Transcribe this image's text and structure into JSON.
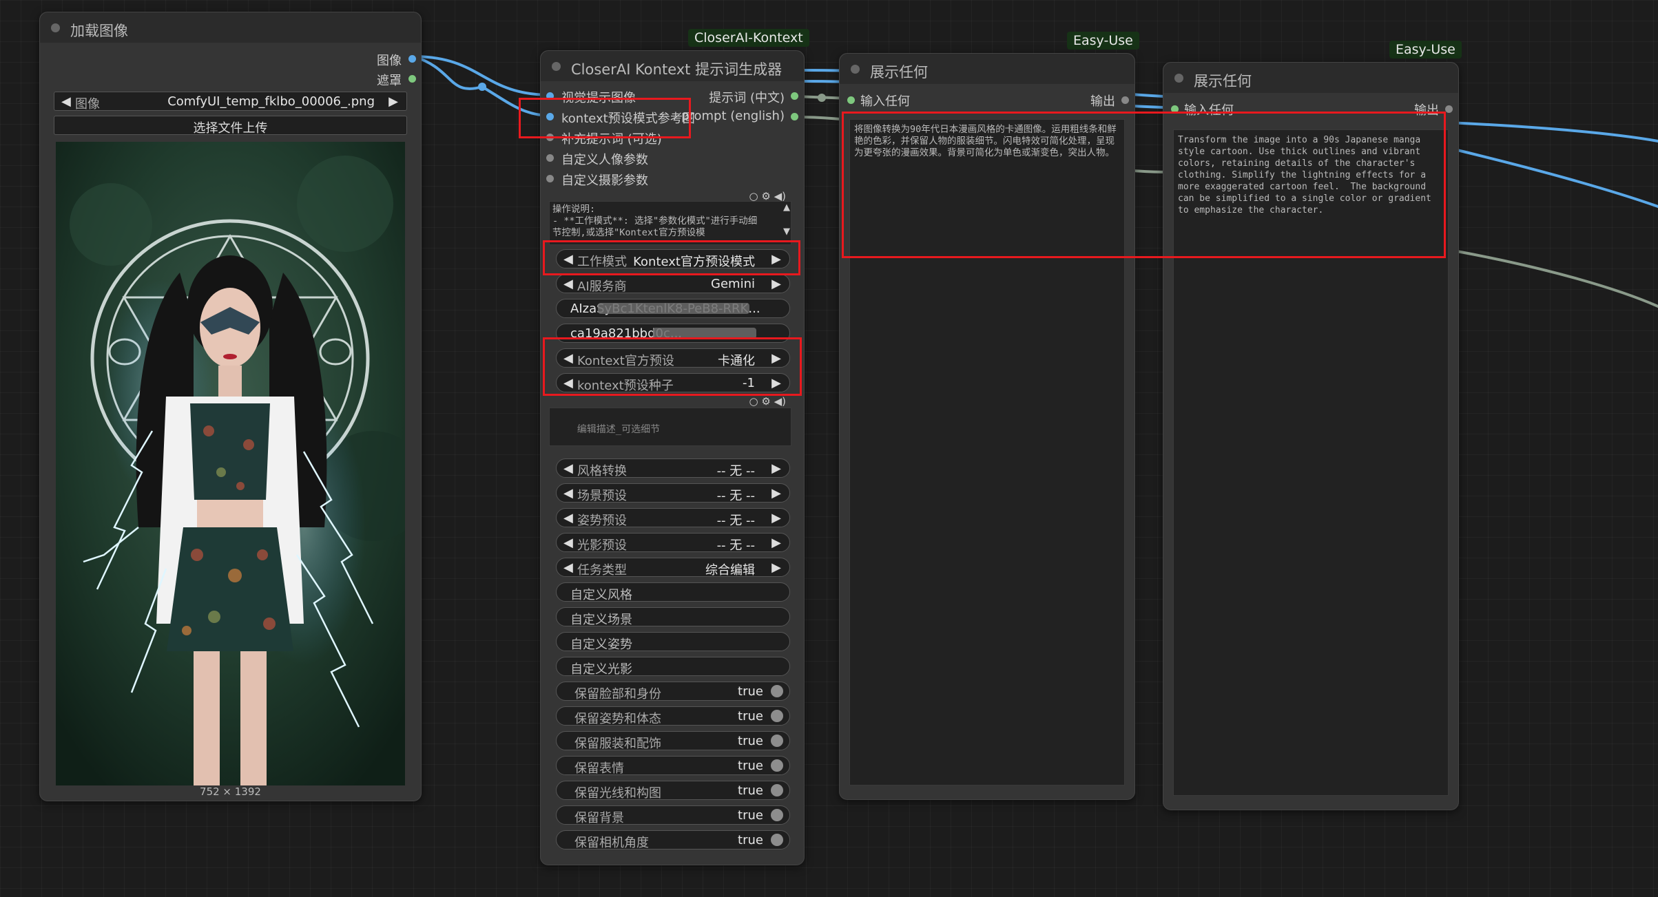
{
  "load_image": {
    "title": "加载图像",
    "outputs": [
      "图像",
      "遮罩"
    ],
    "image_select": {
      "label": "图像",
      "value": "ComfyUI_temp_fklbo_00006_.png"
    },
    "upload_button": "选择文件上传",
    "dimensions": "752 × 1392"
  },
  "kontext_node": {
    "badge": "CloserAI-Kontext",
    "title": "CloserAI Kontext 提示词生成器",
    "inputs": [
      "视觉提示图像",
      "kontext预设模式参考图",
      "补充提示词 (可选)",
      "自定义人像参数",
      "自定义摄影参数"
    ],
    "outputs": [
      "提示词 (中文)",
      "prompt (english)"
    ],
    "instructions": "操作说明:\n- **工作模式**: 选择\"参数化模式\"进行手动细节控制,或选择\"Kontext官方预设模",
    "widgets_top": [
      {
        "label": "工作模式",
        "value": "Kontext官方预设模式"
      },
      {
        "label": "AI服务商",
        "value": "Gemini"
      },
      {
        "label": "",
        "value": "AIzaSyBc1KtenlK8-PeB8-RRK..."
      },
      {
        "label": "",
        "value": "ca19a821bbd0c..."
      },
      {
        "label": "Kontext官方预设",
        "value": "卡通化"
      },
      {
        "label": "kontext预设种子",
        "value": "-1"
      }
    ],
    "edit_placeholder": "编辑描述_可选细节",
    "widgets_combo": [
      {
        "label": "风格转换",
        "value": "-- 无 --"
      },
      {
        "label": "场景预设",
        "value": "-- 无 --"
      },
      {
        "label": "姿势预设",
        "value": "-- 无 --"
      },
      {
        "label": "光影预设",
        "value": "-- 无 --"
      },
      {
        "label": "任务类型",
        "value": "综合编辑"
      }
    ],
    "widgets_text": [
      "自定义风格",
      "自定义场景",
      "自定义姿势",
      "自定义光影"
    ],
    "widgets_toggle": [
      {
        "label": "保留脸部和身份",
        "value": "true"
      },
      {
        "label": "保留姿势和体态",
        "value": "true"
      },
      {
        "label": "保留服装和配饰",
        "value": "true"
      },
      {
        "label": "保留表情",
        "value": "true"
      },
      {
        "label": "保留光线和构图",
        "value": "true"
      },
      {
        "label": "保留背景",
        "value": "true"
      },
      {
        "label": "保留相机角度",
        "value": "true"
      }
    ]
  },
  "show_any_1": {
    "badge": "Easy-Use",
    "title": "展示任何",
    "input": "输入任何",
    "output": "输出",
    "text": "将图像转换为90年代日本漫画风格的卡通图像。运用粗线条和鲜艳的色彩，并保留人物的服装细节。闪电特效可简化处理，呈现为更夸张的漫画效果。背景可简化为单色或渐变色，突出人物。"
  },
  "show_any_2": {
    "badge": "Easy-Use",
    "title": "展示任何",
    "input": "输入任何",
    "output": "输出",
    "text": "Transform the image into a 90s Japanese manga style cartoon. Use thick outlines and vibrant colors, retaining details of the character's clothing. Simplify the lightning effects for a more exaggerated cartoon feel.  The background can be simplified to a single color or gradient to emphasize the character."
  },
  "colors": {
    "link_blue": "#5aa8e8",
    "link_gray": "#8a9a8a",
    "highlight_red": "#e8191e",
    "badge_green": "#163216"
  }
}
